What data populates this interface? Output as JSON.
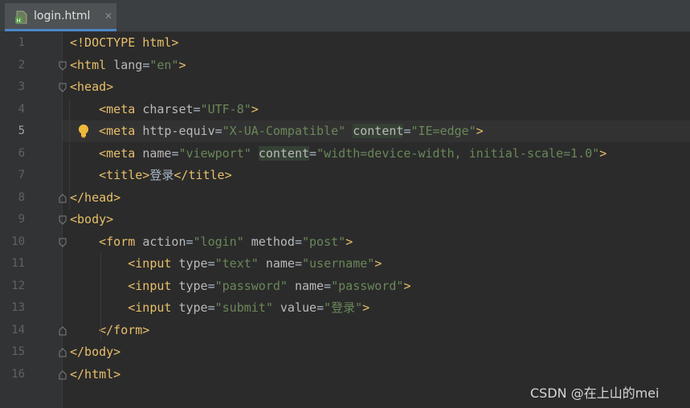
{
  "tab": {
    "label": "login.html"
  },
  "lines": [
    {
      "num": "1",
      "tokens": [
        {
          "t": "tag",
          "v": "<!DOCTYPE html>"
        }
      ]
    },
    {
      "num": "2",
      "tokens": [
        {
          "t": "tag",
          "v": "<html "
        },
        {
          "t": "attr",
          "v": "lang"
        },
        {
          "t": "txt",
          "v": "="
        },
        {
          "t": "val",
          "v": "\"en\""
        },
        {
          "t": "tag",
          "v": ">"
        }
      ]
    },
    {
      "num": "3",
      "tokens": [
        {
          "t": "tag",
          "v": "<head>"
        }
      ]
    },
    {
      "num": "4",
      "tokens": [
        {
          "t": "txt",
          "v": "    "
        },
        {
          "t": "tag",
          "v": "<meta "
        },
        {
          "t": "attr",
          "v": "charset"
        },
        {
          "t": "txt",
          "v": "="
        },
        {
          "t": "val",
          "v": "\"UTF-8\""
        },
        {
          "t": "tag",
          "v": ">"
        }
      ]
    },
    {
      "num": "5",
      "tokens": [
        {
          "t": "txt",
          "v": "    "
        },
        {
          "t": "tag",
          "v": "<meta "
        },
        {
          "t": "attr",
          "v": "http-equiv"
        },
        {
          "t": "txt",
          "v": "="
        },
        {
          "t": "val",
          "v": "\"X-UA-Compatible\""
        },
        {
          "t": "txt",
          "v": " "
        },
        {
          "t": "hl-attr",
          "v": "content"
        },
        {
          "t": "txt",
          "v": "="
        },
        {
          "t": "val",
          "v": "\"IE=edge\""
        },
        {
          "t": "tag",
          "v": ">"
        }
      ]
    },
    {
      "num": "6",
      "tokens": [
        {
          "t": "txt",
          "v": "    "
        },
        {
          "t": "tag",
          "v": "<meta "
        },
        {
          "t": "attr",
          "v": "name"
        },
        {
          "t": "txt",
          "v": "="
        },
        {
          "t": "val",
          "v": "\"viewport\""
        },
        {
          "t": "txt",
          "v": " "
        },
        {
          "t": "hl-attr",
          "v": "content"
        },
        {
          "t": "txt",
          "v": "="
        },
        {
          "t": "val",
          "v": "\"width=device-width, initial-scale=1.0\""
        },
        {
          "t": "tag",
          "v": ">"
        }
      ]
    },
    {
      "num": "7",
      "tokens": [
        {
          "t": "txt",
          "v": "    "
        },
        {
          "t": "tag",
          "v": "<title>"
        },
        {
          "t": "cjk",
          "v": "登录"
        },
        {
          "t": "tag",
          "v": "</title>"
        }
      ]
    },
    {
      "num": "8",
      "tokens": [
        {
          "t": "tag",
          "v": "</head>"
        }
      ]
    },
    {
      "num": "9",
      "tokens": [
        {
          "t": "tag",
          "v": "<body>"
        }
      ]
    },
    {
      "num": "10",
      "tokens": [
        {
          "t": "txt",
          "v": "    "
        },
        {
          "t": "tag",
          "v": "<form "
        },
        {
          "t": "attr",
          "v": "action"
        },
        {
          "t": "txt",
          "v": "="
        },
        {
          "t": "val",
          "v": "\"login\""
        },
        {
          "t": "txt",
          "v": " "
        },
        {
          "t": "attr",
          "v": "method"
        },
        {
          "t": "txt",
          "v": "="
        },
        {
          "t": "val",
          "v": "\"post\""
        },
        {
          "t": "tag",
          "v": ">"
        }
      ]
    },
    {
      "num": "11",
      "tokens": [
        {
          "t": "txt",
          "v": "        "
        },
        {
          "t": "tag",
          "v": "<input "
        },
        {
          "t": "attr",
          "v": "type"
        },
        {
          "t": "txt",
          "v": "="
        },
        {
          "t": "val",
          "v": "\"text\""
        },
        {
          "t": "txt",
          "v": " "
        },
        {
          "t": "attr",
          "v": "name"
        },
        {
          "t": "txt",
          "v": "="
        },
        {
          "t": "val",
          "v": "\"username\""
        },
        {
          "t": "tag",
          "v": ">"
        }
      ]
    },
    {
      "num": "12",
      "tokens": [
        {
          "t": "txt",
          "v": "        "
        },
        {
          "t": "tag",
          "v": "<input "
        },
        {
          "t": "attr",
          "v": "type"
        },
        {
          "t": "txt",
          "v": "="
        },
        {
          "t": "val",
          "v": "\"password\""
        },
        {
          "t": "txt",
          "v": " "
        },
        {
          "t": "attr",
          "v": "name"
        },
        {
          "t": "txt",
          "v": "="
        },
        {
          "t": "val",
          "v": "\"password\""
        },
        {
          "t": "tag",
          "v": ">"
        }
      ]
    },
    {
      "num": "13",
      "tokens": [
        {
          "t": "txt",
          "v": "        "
        },
        {
          "t": "tag",
          "v": "<input "
        },
        {
          "t": "attr",
          "v": "type"
        },
        {
          "t": "txt",
          "v": "="
        },
        {
          "t": "val",
          "v": "\"submit\""
        },
        {
          "t": "txt",
          "v": " "
        },
        {
          "t": "attr",
          "v": "value"
        },
        {
          "t": "txt",
          "v": "="
        },
        {
          "t": "val",
          "v": "\"登录\""
        },
        {
          "t": "tag",
          "v": ">"
        }
      ]
    },
    {
      "num": "14",
      "tokens": [
        {
          "t": "txt",
          "v": "    "
        },
        {
          "t": "tag",
          "v": "</form>"
        }
      ]
    },
    {
      "num": "15",
      "tokens": [
        {
          "t": "tag",
          "v": "</body>"
        }
      ]
    },
    {
      "num": "16",
      "tokens": [
        {
          "t": "tag",
          "v": "</html>"
        }
      ]
    }
  ],
  "current_line": "5",
  "fold_markers": [
    "2",
    "3",
    "8",
    "9",
    "10",
    "14",
    "15",
    "16"
  ],
  "icons": {
    "file": "html-file-icon",
    "close": "close-icon",
    "bulb": "intention-bulb-icon"
  },
  "colors": {
    "background": "#2b2b2b",
    "tag": "#e8bf6a",
    "attr": "#bababa",
    "value": "#6a8759",
    "accent": "#4a88c7"
  },
  "watermark": "CSDN @在上山的mei"
}
